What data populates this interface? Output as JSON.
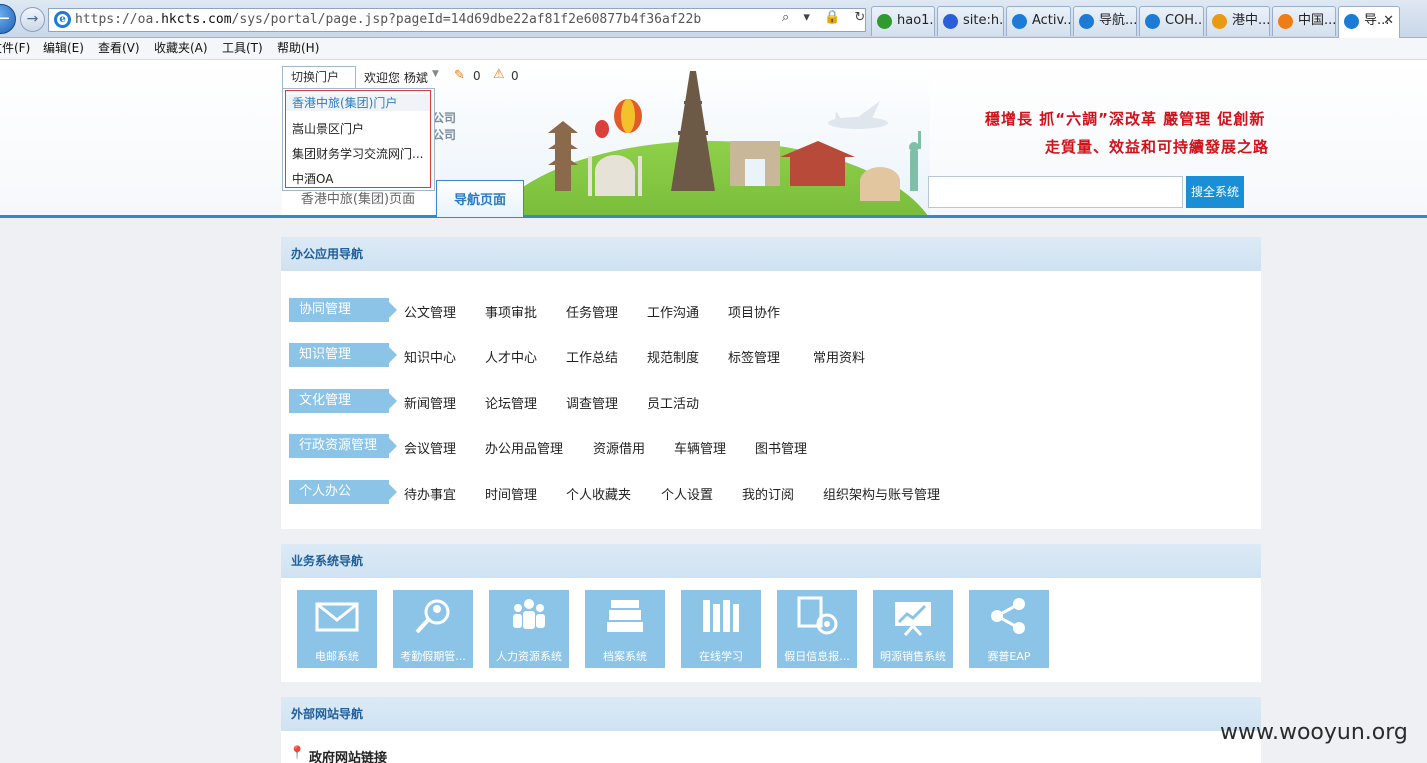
{
  "browser": {
    "url_pre": "https://oa.",
    "url_domain": "hkcts.com",
    "url_post": "/sys/portal/page.jsp?pageId=14d69dbe22af81f2e60877b4f36af22b",
    "addr_tools": "⌕ ▾ 🔒 ↻ ✕",
    "tabs": [
      {
        "label": "hao1...",
        "icon": "hao-icon",
        "color": "#2f9a2f"
      },
      {
        "label": "site:h...",
        "icon": "paw-icon",
        "color": "#2b5fd9"
      },
      {
        "label": "Activ...",
        "icon": "ie-icon",
        "color": "#1c7bd6"
      },
      {
        "label": "导航...",
        "icon": "ie-icon",
        "color": "#1c7bd6"
      },
      {
        "label": "COH...",
        "icon": "ie-icon",
        "color": "#1c7bd6"
      },
      {
        "label": "港中...",
        "icon": "weibo-icon",
        "color": "#e79a12"
      },
      {
        "label": "中国...",
        "icon": "swirl-icon",
        "color": "#ef7d15"
      },
      {
        "label": "导...",
        "icon": "ie-icon",
        "color": "#1c7bd6"
      }
    ]
  },
  "menubar": [
    "文件(F)",
    "编辑(E)",
    "查看(V)",
    "收藏夹(A)",
    "工具(T)",
    "帮助(H)"
  ],
  "header": {
    "switch_portal": "切换门户",
    "welcome": "欢迎您 杨斌",
    "edit_count": "0",
    "warn_count": "0",
    "logo_line1": "公司",
    "logo_line2": "公司",
    "slogan1": "穩增長 抓“六調”深改革 嚴管理 促創新",
    "slogan2": "走質量、效益和可持續發展之路",
    "search_btn": "搜全系统",
    "tab_home": "香港中旅(集团)页面",
    "tab_nav": "导航页面"
  },
  "dropdown": [
    "香港中旅(集团)门户",
    "嵩山景区门户",
    "集团财务学习交流网门...",
    "中酒OA"
  ],
  "office_nav": {
    "title": "办公应用导航",
    "rows": [
      {
        "category": "协同管理",
        "links": [
          "公文管理",
          "事项审批",
          "任务管理",
          "工作沟通",
          "项目协作"
        ]
      },
      {
        "category": "知识管理",
        "links": [
          "知识中心",
          "人才中心",
          "工作总结",
          "规范制度",
          "标签管理",
          "常用资料"
        ]
      },
      {
        "category": "文化管理",
        "links": [
          "新闻管理",
          "论坛管理",
          "调查管理",
          "员工活动"
        ]
      },
      {
        "category": "行政资源管理",
        "links": [
          "会议管理",
          "办公用品管理",
          "资源借用",
          "车辆管理",
          "图书管理"
        ]
      },
      {
        "category": "个人办公",
        "links": [
          "待办事宜",
          "时间管理",
          "个人收藏夹",
          "个人设置",
          "我的订阅",
          "组织架构与账号管理"
        ]
      }
    ]
  },
  "business_nav": {
    "title": "业务系统导航",
    "tiles": [
      {
        "label": "电邮系统",
        "icon": "mail-icon"
      },
      {
        "label": "考勤假期管...",
        "icon": "user-search-icon"
      },
      {
        "label": "人力资源系统",
        "icon": "people-icon"
      },
      {
        "label": "档案系统",
        "icon": "archive-icon"
      },
      {
        "label": "在线学习",
        "icon": "books-icon"
      },
      {
        "label": "假日信息报...",
        "icon": "doc-gear-icon"
      },
      {
        "label": "明源销售系统",
        "icon": "chart-board-icon"
      },
      {
        "label": "赛普EAP",
        "icon": "share-icon"
      }
    ]
  },
  "external_nav": {
    "title": "外部网站导航",
    "sub": "政府网站链接"
  },
  "watermark": "www.wooyun.org"
}
